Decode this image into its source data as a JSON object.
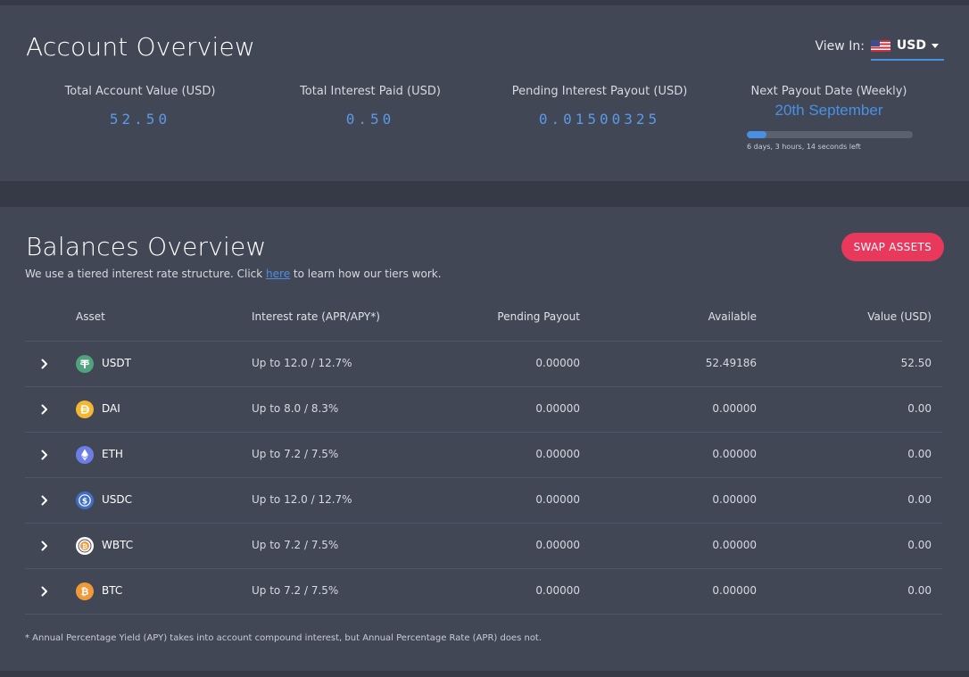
{
  "account": {
    "title": "Account Overview",
    "view_in_label": "View In:",
    "currency": "USD",
    "stats": {
      "total_label": "Total Account Value (USD)",
      "total_value": "52.50",
      "interest_label": "Total Interest Paid (USD)",
      "interest_value": "0.50",
      "pending_label": "Pending Interest Payout (USD)",
      "pending_value": "0.01500325",
      "next_label": "Next Payout Date (Weekly)",
      "next_date": "20th September",
      "time_left": "6 days, 3 hours, 14 seconds left",
      "progress_fraction": 0.12
    }
  },
  "balances": {
    "title": "Balances Overview",
    "subtitle_before": "We use a tiered interest rate structure. Click ",
    "subtitle_link": "here",
    "subtitle_after": " to learn how our tiers work.",
    "swap_label": "SWAP ASSETS",
    "headers": {
      "asset": "Asset",
      "rate": "Interest rate (APR/APY*)",
      "pending": "Pending Payout",
      "available": "Available",
      "value": "Value (USD)"
    },
    "rows": [
      {
        "asset": "USDT",
        "icon": "usdt-icon",
        "color": "#4fa37d",
        "rate": "Up to 12.0 / 12.7%",
        "pending": "0.00000",
        "available": "52.49186",
        "value": "52.50"
      },
      {
        "asset": "DAI",
        "icon": "dai-icon",
        "color": "#f4b731",
        "rate": "Up to 8.0 / 8.3%",
        "pending": "0.00000",
        "available": "0.00000",
        "value": "0.00"
      },
      {
        "asset": "ETH",
        "icon": "eth-icon",
        "color": "#6c7ee6",
        "rate": "Up to 7.2 / 7.5%",
        "pending": "0.00000",
        "available": "0.00000",
        "value": "0.00"
      },
      {
        "asset": "USDC",
        "icon": "usdc-icon",
        "color": "#3f6fc4",
        "rate": "Up to 12.0 / 12.7%",
        "pending": "0.00000",
        "available": "0.00000",
        "value": "0.00"
      },
      {
        "asset": "WBTC",
        "icon": "wbtc-icon",
        "color": "#ffffff",
        "rate": "Up to 7.2 / 7.5%",
        "pending": "0.00000",
        "available": "0.00000",
        "value": "0.00"
      },
      {
        "asset": "BTC",
        "icon": "btc-icon",
        "color": "#f09a37",
        "rate": "Up to 7.2 / 7.5%",
        "pending": "0.00000",
        "available": "0.00000",
        "value": "0.00"
      }
    ],
    "footnote": "* Annual Percentage Yield (APY) takes into account compound interest, but Annual Percentage Rate (APR) does not."
  },
  "colors": {
    "accent": "#4a90e2",
    "swap_button": "#e8385c",
    "card_bg": "#424755",
    "page_bg": "#353a46"
  }
}
